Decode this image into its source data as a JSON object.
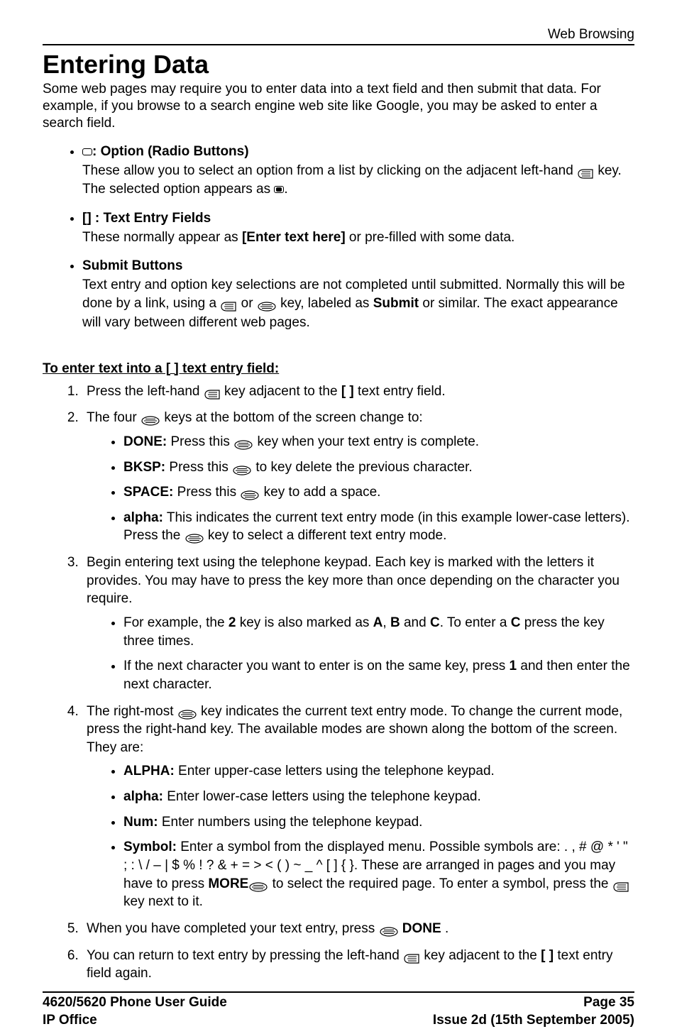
{
  "header": {
    "section": "Web Browsing"
  },
  "title": "Entering Data",
  "intro": "Some web pages may require you to enter data into a text field and then submit that data. For example, if you browse to a search engine web site like Google, you may be asked to enter a search field.",
  "bullets": {
    "radio": {
      "label": ": Option (Radio Buttons)",
      "line1a": "These allow you to select an option from a list by clicking on the adjacent left-hand ",
      "line1b": " key. The selected option appears as ",
      "line1c": "."
    },
    "text": {
      "label": "[] : Text Entry Fields",
      "line1a": "These normally appear as ",
      "line1b": "[Enter text here]",
      "line1c": " or pre-filled with some data."
    },
    "submit": {
      "label": "Submit Buttons",
      "line1a": "Text entry and option key selections are not completed until submitted. Normally this will be done by a link, using a ",
      "line1b": " or ",
      "line1c": " key, labeled as ",
      "line1d": "Submit",
      "line1e": " or similar. The exact appearance will vary between different web pages."
    }
  },
  "subhead": "To enter text into a [ ] text entry field:",
  "steps": {
    "s1a": "Press the left-hand ",
    "s1b": " key adjacent to the ",
    "s1c": "[ ]",
    "s1d": " text entry field.",
    "s2a": "The four ",
    "s2b": " keys at the bottom of the screen change to:",
    "s2_done_l": "DONE:",
    "s2_done_a": " Press this ",
    "s2_done_b": " key when your text entry is complete.",
    "s2_bksp_l": "BKSP:",
    "s2_bksp_a": " Press this ",
    "s2_bksp_b": " to key delete the previous character.",
    "s2_space_l": "SPACE:",
    "s2_space_a": " Press this ",
    "s2_space_b": " key to add a space.",
    "s2_alpha_l": "alpha:",
    "s2_alpha_a": " This indicates the current text entry mode (in this example lower-case letters). Press the ",
    "s2_alpha_b": " key to select a different text entry mode.",
    "s3a": "Begin entering text using the telephone keypad. Each key is marked with the letters it provides. You may have to press the key more than once depending on the character you require.",
    "s3_ex1a": "For example, the ",
    "s3_ex1b": "2",
    "s3_ex1c": " key is also marked as ",
    "s3_ex1d": "A",
    "s3_ex1e": ", ",
    "s3_ex1f": "B",
    "s3_ex1g": " and ",
    "s3_ex1h": "C",
    "s3_ex1i": ". To enter a ",
    "s3_ex1j": "C",
    "s3_ex1k": " press the key three times.",
    "s3_ex2a": "If the next character you want to enter is on the same key, press ",
    "s3_ex2b": "1",
    "s3_ex2c": " and then enter the next character.",
    "s4a": "The right-most ",
    "s4b": " key indicates the current text entry mode. To change the current mode, press the right-hand key. The available modes are shown along the bottom of the screen. They are:",
    "s4_ALPHA_l": "ALPHA:",
    "s4_ALPHA_t": " Enter upper-case letters using the telephone keypad.",
    "s4_alpha_l": "alpha:",
    "s4_alpha_t": " Enter lower-case letters using the telephone keypad.",
    "s4_num_l": "Num:",
    "s4_num_t": " Enter numbers using the telephone keypad.",
    "s4_sym_l": "Symbol:",
    "s4_sym_a": " Enter a symbol from the displayed menu. Possible symbols are: . , # @ * ' \" ; : \\ / – | $ % ! ? & + = > < ( ) ~ _ ^ [ ] { }. These are arranged in pages and you may have to press ",
    "s4_sym_b": "MORE",
    "s4_sym_c": " to select the required page. To enter a symbol, press the ",
    "s4_sym_d": " key next to it.",
    "s5a": "When you have completed your text entry, press ",
    "s5b": " DONE",
    "s5c": " .",
    "s6a": "You can return to text entry by pressing the left-hand ",
    "s6b": " key adjacent to the ",
    "s6c": "[ ]",
    "s6d": " text entry field again."
  },
  "footer": {
    "left1": "4620/5620 Phone User Guide",
    "left2": "IP Office",
    "right1": "Page 35",
    "right2": "Issue 2d (15th September 2005)"
  }
}
